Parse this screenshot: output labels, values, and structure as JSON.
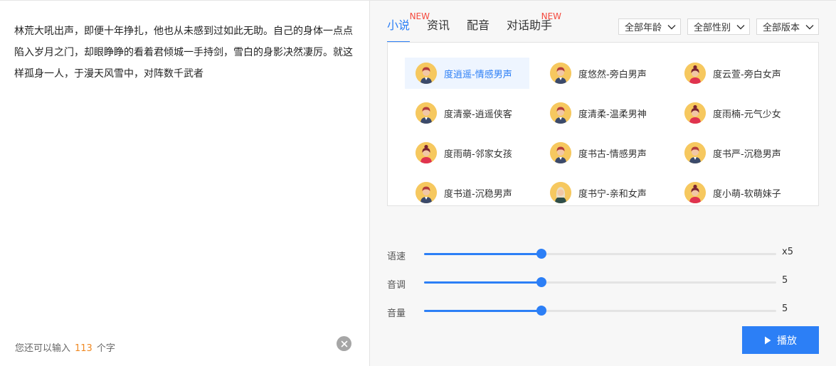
{
  "editor": {
    "text": "林荒大吼出声，即便十年挣扎，他也从未感到过如此无助。自己的身体一点点陷入岁月之门，却眼睁睁的看着君倾城一手持剑，雪白的身影决然凄厉。就这样孤身一人，于漫天风雪中，对阵数千武者",
    "counter_prefix": "您还可以输入",
    "counter_value": "113",
    "counter_suffix": "个字"
  },
  "tabs": [
    {
      "label": "小说",
      "badge": "NEW",
      "active": true
    },
    {
      "label": "资讯",
      "badge": "",
      "active": false
    },
    {
      "label": "配音",
      "badge": "",
      "active": false
    },
    {
      "label": "对话助手",
      "badge": "NEW",
      "active": false
    }
  ],
  "filters": [
    {
      "label": "全部年龄"
    },
    {
      "label": "全部性别"
    },
    {
      "label": "全部版本"
    }
  ],
  "voices": [
    {
      "name": "度逍遥-情感男声",
      "avatar": "male",
      "selected": true
    },
    {
      "name": "度悠然-旁白男声",
      "avatar": "male",
      "selected": false
    },
    {
      "name": "度云萱-旁白女声",
      "avatar": "female",
      "selected": false
    },
    {
      "name": "度清豪-逍遥侠客",
      "avatar": "male",
      "selected": false
    },
    {
      "name": "度清柔-温柔男神",
      "avatar": "male",
      "selected": false
    },
    {
      "name": "度雨楠-元气少女",
      "avatar": "female",
      "selected": false
    },
    {
      "name": "度雨萌-邻家女孩",
      "avatar": "female",
      "selected": false
    },
    {
      "name": "度书古-情感男声",
      "avatar": "male",
      "selected": false
    },
    {
      "name": "度书严-沉稳男声",
      "avatar": "male",
      "selected": false
    },
    {
      "name": "度书道-沉稳男声",
      "avatar": "male",
      "selected": false
    },
    {
      "name": "度书宁-亲和女声",
      "avatar": "female-light",
      "selected": false
    },
    {
      "name": "度小萌-软萌妹子",
      "avatar": "female",
      "selected": false
    }
  ],
  "sliders": [
    {
      "label": "语速",
      "value_text": "x5",
      "fraction": 0.333
    },
    {
      "label": "音调",
      "value_text": "5",
      "fraction": 0.333
    },
    {
      "label": "音量",
      "value_text": "5",
      "fraction": 0.333
    }
  ],
  "play_button": {
    "label": "播放",
    "icon": "play-icon"
  },
  "colors": {
    "accent": "#2c7ff6",
    "badge": "#f5493d",
    "counter": "#f08a24"
  }
}
